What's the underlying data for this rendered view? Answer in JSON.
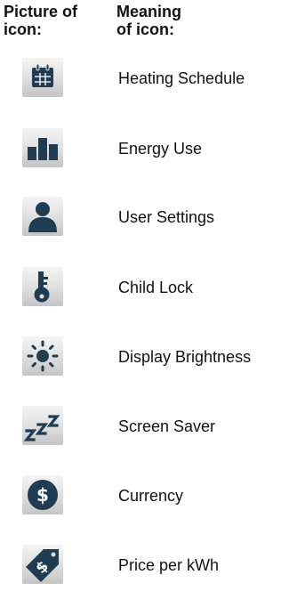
{
  "header": {
    "picture_line1": "Picture of",
    "picture_line2": "icon:",
    "meaning_line1": "Meaning",
    "meaning_line2": "of icon:"
  },
  "icon_color": "#1f3d52",
  "rows": [
    {
      "icon": "calendar-icon",
      "label": "Heating Schedule"
    },
    {
      "icon": "bar-chart-icon",
      "label": "Energy Use"
    },
    {
      "icon": "user-icon",
      "label": "User Settings"
    },
    {
      "icon": "key-icon",
      "label": "Child Lock"
    },
    {
      "icon": "sun-icon",
      "label": "Display Brightness"
    },
    {
      "icon": "sleep-zzz-icon",
      "label": "Screen Saver"
    },
    {
      "icon": "dollar-coin-icon",
      "label": "Currency"
    },
    {
      "icon": "price-tag-icon",
      "label": "Price per kWh"
    }
  ]
}
